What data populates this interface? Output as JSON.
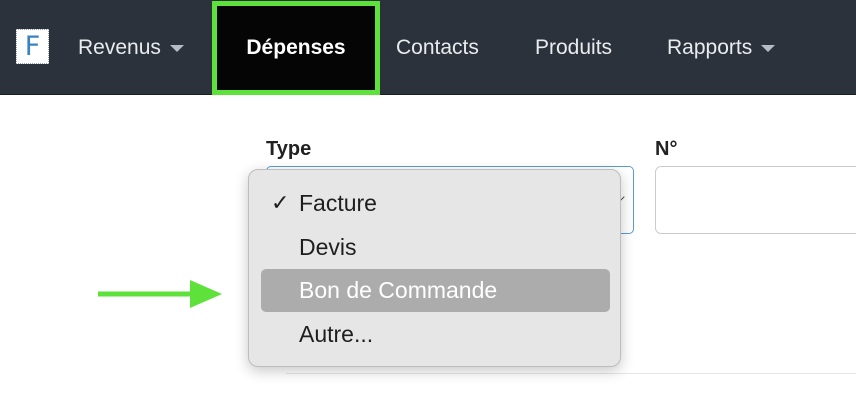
{
  "nav": {
    "logo_letter": "F",
    "items": [
      {
        "label": "Revenus",
        "dropdown": true
      },
      {
        "label": "Dépenses",
        "active": true
      },
      {
        "label": "Contacts"
      },
      {
        "label": "Produits"
      },
      {
        "label": "Rapports",
        "dropdown": true
      }
    ]
  },
  "form": {
    "type_label": "Type",
    "number_label": "N°"
  },
  "dropdown": {
    "options": [
      {
        "label": "Facture",
        "checked": true
      },
      {
        "label": "Devis"
      },
      {
        "label": "Bon de Commande",
        "highlighted": true
      },
      {
        "label": "Autre..."
      }
    ],
    "check_glyph": "✓"
  },
  "colors": {
    "navbar_bg": "#2c323b",
    "active_highlight_border": "#5ee23b",
    "active_bg": "#050505",
    "arrow": "#5ee23b",
    "select_focus_border": "#5b9bd5",
    "menu_bg": "#e6e6e6",
    "menu_highlight": "#acacac"
  }
}
